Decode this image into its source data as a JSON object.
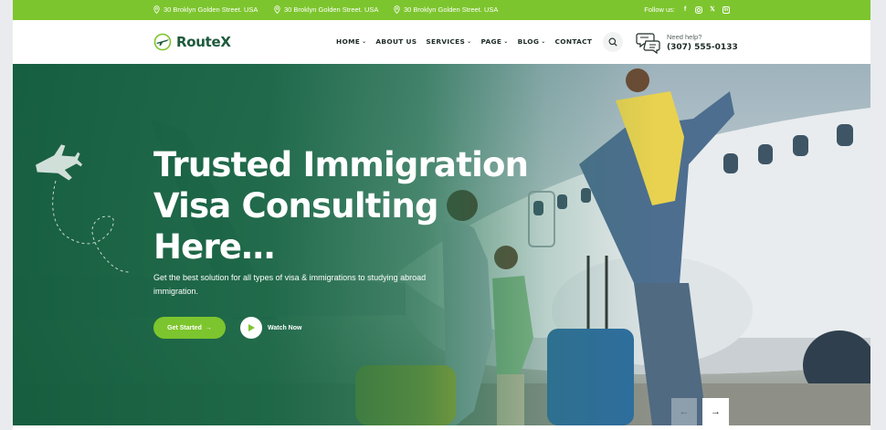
{
  "topbar": {
    "addresses": [
      "30 Broklyn Golden Street. USA",
      "30 Broklyn Golden Street. USA",
      "30 Broklyn Golden Street. USA"
    ],
    "follow_label": "Follow us:",
    "socials": [
      "facebook-icon",
      "instagram-icon",
      "x-icon",
      "linkedin-icon"
    ]
  },
  "header": {
    "logo_text": "RouteX",
    "nav": [
      {
        "label": "HOME",
        "dropdown": true
      },
      {
        "label": "ABOUT US",
        "dropdown": false
      },
      {
        "label": "SERVICES",
        "dropdown": true
      },
      {
        "label": "PAGE",
        "dropdown": true
      },
      {
        "label": "BLOG",
        "dropdown": true
      },
      {
        "label": "CONTACT",
        "dropdown": false
      }
    ],
    "help_label": "Need help?",
    "help_phone": "(307) 555-0133"
  },
  "hero": {
    "title_line1": "Trusted Immigration",
    "title_line2": "Visa Consulting",
    "title_line3": "Here…",
    "subtitle": "Get the best solution for all types of visa & immigrations to studying abroad immigration.",
    "cta_label": "Get Started",
    "watch_label": "Watch Now"
  },
  "colors": {
    "accent": "#7dc52e",
    "brand_dark": "#1d5a3c",
    "overlay": "#12603e"
  }
}
